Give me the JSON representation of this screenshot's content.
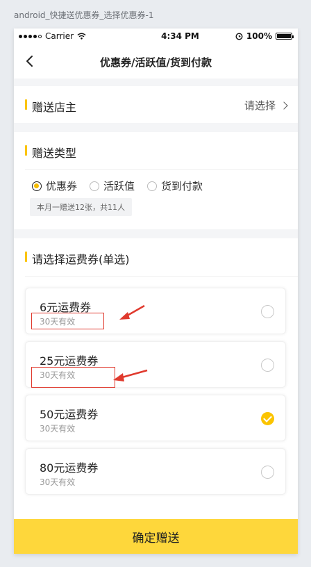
{
  "artboard_label": "android_快捷送优惠券_选择优惠券-1",
  "status_bar": {
    "carrier": "Carrier",
    "time": "4:34 PM",
    "battery": "100%"
  },
  "nav": {
    "title": "优惠券/活跃值/货到付款"
  },
  "owner_section": {
    "title": "赠送店主",
    "action": "请选择"
  },
  "type_section": {
    "title": "赠送类型",
    "options": [
      {
        "label": "优惠券",
        "selected": true
      },
      {
        "label": "活跃值",
        "selected": false
      },
      {
        "label": "货到付款",
        "selected": false
      }
    ],
    "note": "本月一赠送12张，共11人"
  },
  "coupon_section": {
    "title": "请选择运费券(单选)",
    "coupons": [
      {
        "name": "6元运费券",
        "validity": "30天有效",
        "selected": false
      },
      {
        "name": "25元运费券",
        "validity": "30天有效",
        "selected": false
      },
      {
        "name": "50元运费券",
        "validity": "30天有效",
        "selected": true
      },
      {
        "name": "80元运费券",
        "validity": "30天有效",
        "selected": false
      }
    ]
  },
  "confirm_button": "确定赠送",
  "colors": {
    "accent": "#fbc400",
    "button": "#fed73b",
    "annotation": "#e03a2e"
  }
}
